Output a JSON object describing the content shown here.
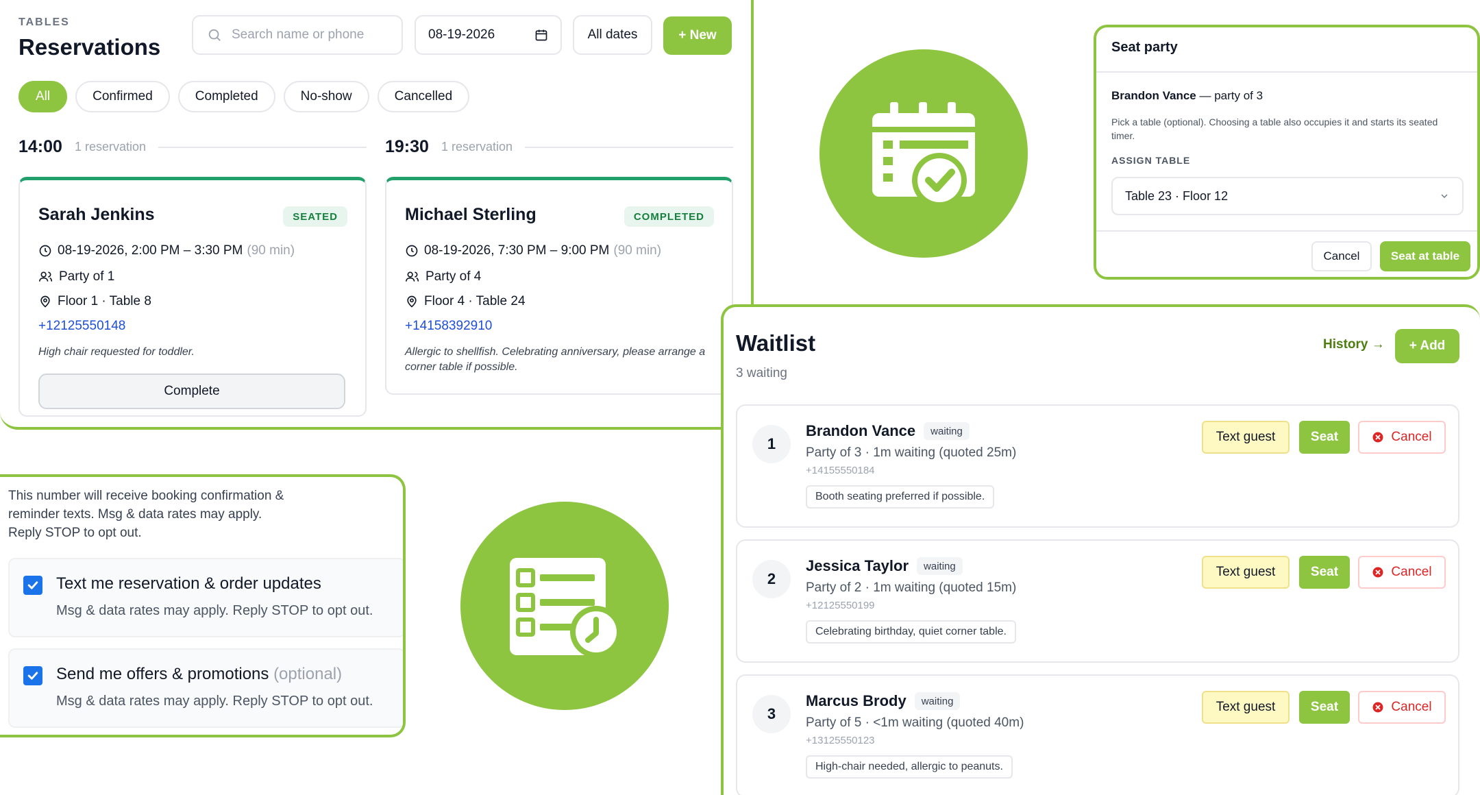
{
  "reservations": {
    "section_label": "TABLES",
    "title": "Reservations",
    "search_placeholder": "Search name or phone",
    "date_value": "08-19-2026",
    "all_dates_label": "All dates",
    "new_label": "+ New",
    "filters": [
      "All",
      "Confirmed",
      "Completed",
      "No-show",
      "Cancelled"
    ],
    "active_filter": "All",
    "slots": [
      {
        "time": "14:00",
        "count": "1 reservation",
        "card": {
          "name": "Sarah Jenkins",
          "status": "SEATED",
          "datetime": "08-19-2026, 2:00 PM – 3:30 PM",
          "duration": "(90 min)",
          "party": "Party of 1",
          "location": "Floor 1 · Table 8",
          "phone": "+12125550148",
          "note": "High chair requested for toddler.",
          "action": "Complete"
        }
      },
      {
        "time": "19:30",
        "count": "1 reservation",
        "card": {
          "name": "Michael Sterling",
          "status": "COMPLETED",
          "datetime": "08-19-2026, 7:30 PM – 9:00 PM",
          "duration": "(90 min)",
          "party": "Party of 4",
          "location": "Floor 4 · Table 24",
          "phone": "+14158392910",
          "note": "Allergic to shellfish. Celebrating anniversary, please arrange a corner table if possible."
        }
      }
    ]
  },
  "seat_party": {
    "title": "Seat party",
    "guest_name": "Brandon Vance",
    "guest_party": " — party of 3",
    "help": "Pick a table (optional). Choosing a table also occupies it and starts its seated timer.",
    "assign_label": "ASSIGN TABLE",
    "selected_table": "Table 23 · Floor 12",
    "cancel_label": "Cancel",
    "confirm_label": "Seat at table"
  },
  "waitlist": {
    "title": "Waitlist",
    "subtitle": "3 waiting",
    "history_label": "History →",
    "add_label": "+ Add",
    "text_label": "Text guest",
    "seat_label": "Seat",
    "cancel_label": "Cancel",
    "entries": [
      {
        "num": "1",
        "name": "Brandon Vance",
        "status": "waiting",
        "party": "Party of 3 · 1m waiting (quoted 25m)",
        "phone": "+14155550184",
        "note": "Booth seating preferred if possible."
      },
      {
        "num": "2",
        "name": "Jessica Taylor",
        "status": "waiting",
        "party": "Party of 2 · 1m waiting (quoted 15m)",
        "phone": "+12125550199",
        "note": "Celebrating birthday, quiet corner table."
      },
      {
        "num": "3",
        "name": "Marcus Brody",
        "status": "waiting",
        "party": "Party of 5 · <1m waiting (quoted 40m)",
        "phone": "+13125550123",
        "note": "High-chair needed, allergic to peanuts."
      }
    ]
  },
  "consent": {
    "info": "This number will receive booking confirmation & reminder texts. Msg & data rates may apply. Reply STOP to opt out.",
    "options": [
      {
        "title": "Text me reservation & order updates",
        "optional": "",
        "sub": "Msg & data rates may apply. Reply STOP to opt out.",
        "checked": true
      },
      {
        "title": "Send me offers & promotions",
        "optional": "(optional)",
        "sub": "Msg & data rates may apply. Reply STOP to opt out.",
        "checked": true
      }
    ]
  },
  "colors": {
    "accent": "#8dc440",
    "seated_bar": "#22a06b",
    "link": "#1d4ed8",
    "danger": "#dc2626",
    "checkbox": "#1a73e8"
  },
  "icons": {
    "calendar": "calendar-check-icon",
    "list": "list-clock-icon"
  }
}
